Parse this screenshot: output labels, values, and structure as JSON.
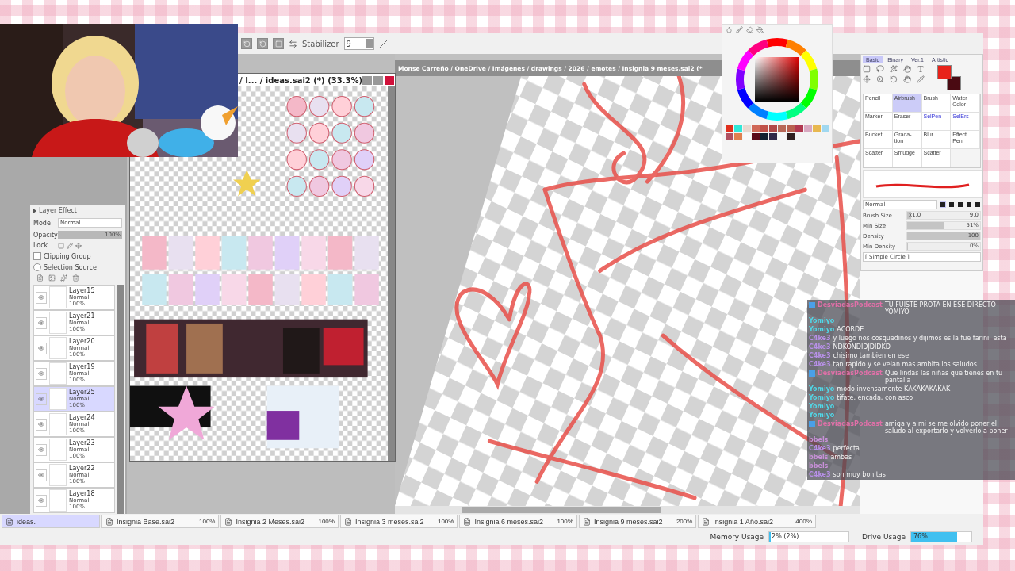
{
  "toolbar": {
    "stabilizer_label": "Stabilizer",
    "stabilizer_value": "9"
  },
  "ideas_window": {
    "title": "/ I... / ideas.sai2 (*) (33.3%)"
  },
  "canvas": {
    "path": "Monse Carreño / OneDrive / Imágenes / drawings / 2026 / emotes / Insignia 9 meses.sai2 (*"
  },
  "layer_effect": {
    "title": "Layer Effect",
    "mode_label": "Mode",
    "mode": "Normal",
    "opacity_label": "Opacity",
    "opacity": {
      "value": "100%",
      "level": 1
    },
    "lock_label": "Lock",
    "clipping_label": "Clipping Group",
    "clipping_checked": false,
    "selection_label": "Selection Source",
    "selection_checked": false
  },
  "layers": [
    {
      "name": "Layer15",
      "mode": "Normal",
      "opacity": "100%",
      "selected": false
    },
    {
      "name": "Layer21",
      "mode": "Normal",
      "opacity": "100%",
      "selected": false
    },
    {
      "name": "Layer20",
      "mode": "Normal",
      "opacity": "100%",
      "selected": false
    },
    {
      "name": "Layer19",
      "mode": "Normal",
      "opacity": "100%",
      "selected": false
    },
    {
      "name": "Layer25",
      "mode": "Normal",
      "opacity": "100%",
      "selected": true
    },
    {
      "name": "Layer24",
      "mode": "Normal",
      "opacity": "100%",
      "selected": false
    },
    {
      "name": "Layer23",
      "mode": "Normal",
      "opacity": "100%",
      "selected": false
    },
    {
      "name": "Layer22",
      "mode": "Normal",
      "opacity": "100%",
      "selected": false
    },
    {
      "name": "Layer18",
      "mode": "Normal",
      "opacity": "100%",
      "selected": false
    }
  ],
  "color_panel": {
    "swatches": [
      {
        "color": "#e0301e"
      },
      {
        "color": "#30e8d8"
      },
      {
        "color": "#e8d8d0"
      },
      {
        "color": "#d06858"
      },
      {
        "color": "#c05048"
      },
      {
        "color": "#b04848"
      },
      {
        "color": "#b86858"
      },
      {
        "color": "#b86050"
      },
      {
        "color": "#b03850"
      },
      {
        "color": "#d8a8c0"
      },
      {
        "color": "#e8b850"
      },
      {
        "color": "#a0d8f0"
      },
      {
        "color": "#b05060"
      },
      {
        "color": "#e08050"
      },
      {
        "color": "#f8f8f8"
      },
      {
        "color": "#5a0818"
      },
      {
        "color": "#102030"
      },
      {
        "color": "#302848"
      },
      {
        "color": "#f8f8f8"
      },
      {
        "color": "#302020"
      }
    ]
  },
  "tools": {
    "tabs": [
      {
        "label": "Basic",
        "selected": true
      },
      {
        "label": "Binary",
        "selected": false
      },
      {
        "label": "Ver.1",
        "selected": false
      },
      {
        "label": "Artistic",
        "selected": false
      }
    ],
    "colors": [
      {
        "color": "#e8221a"
      },
      {
        "color": "#4a0a12"
      }
    ],
    "brushes": [
      {
        "label": "Pencil",
        "kind": "paint",
        "selected": false
      },
      {
        "label": "Airbrush",
        "kind": "paint",
        "selected": true
      },
      {
        "label": "Brush",
        "kind": "paint",
        "selected": false
      },
      {
        "label": "Water Color",
        "kind": "paint",
        "selected": false
      },
      {
        "label": "Marker",
        "kind": "paint",
        "selected": false
      },
      {
        "label": "Eraser",
        "kind": "paint",
        "selected": false
      },
      {
        "label": "SelPen",
        "kind": "selection",
        "selected": false
      },
      {
        "label": "SelErs",
        "kind": "selection",
        "selected": false
      },
      {
        "label": "Bucket",
        "kind": "paint",
        "selected": false
      },
      {
        "label": "Grada- tion",
        "kind": "paint",
        "selected": false
      },
      {
        "label": "Blur",
        "kind": "paint",
        "selected": false
      },
      {
        "label": "Effect Pen",
        "kind": "paint",
        "selected": false
      },
      {
        "label": "Scatter",
        "kind": "paint",
        "selected": false
      },
      {
        "label": "Smudge",
        "kind": "paint",
        "selected": false
      },
      {
        "label": "Scatter",
        "kind": "paint",
        "selected": false
      }
    ],
    "blend_mode": "Normal",
    "params": [
      {
        "label": "Brush Size",
        "prefix": "x1.0",
        "value": "9.0",
        "level": 0.05
      },
      {
        "label": "Min Size",
        "value": "51%",
        "level": 0.51
      },
      {
        "label": "Density",
        "value": "100",
        "level": 1
      },
      {
        "label": "Min Density",
        "value": "0%",
        "level": 0
      }
    ],
    "shape": "[ Simple Circle ]"
  },
  "chat": [
    {
      "user": "DesviadasPodcast",
      "color": "#e070a8",
      "badge": true,
      "text": "TU FUISTE PROTA EN ESE DIRECTO YOMIYO"
    },
    {
      "user": "Yomiyo",
      "color": "#50d8e8"
    },
    {
      "user": "Yomiyo",
      "color": "#50d8e8",
      "text": "ACORDE"
    },
    {
      "user": "C4ke3",
      "color": "#b890e8",
      "text": "y luego nos cosquedinos y dijimos es la fue farini. esta"
    },
    {
      "user": "C4ke3",
      "color": "#b890e8",
      "text": "NDKONDIDJDIDKD"
    },
    {
      "user": "C4ke3",
      "color": "#b890e8",
      "text": "chisimo tambien en ese"
    },
    {
      "user": "C4ke3",
      "color": "#b890e8",
      "text": "tan rapido y se veian mas ambita los saludos"
    },
    {
      "user": "DesviadasPodcast",
      "color": "#e070a8",
      "badge": true,
      "text": "Que lindas las niñas que tienes en tu pantalla"
    },
    {
      "user": "Yomiyo",
      "color": "#50d8e8",
      "text": "modo invensamente KAKAKAKAKAK"
    },
    {
      "user": "Yomiyo",
      "color": "#50d8e8",
      "text": "tifate, encada, con asco"
    },
    {
      "user": "Yomiyo",
      "color": "#50d8e8"
    },
    {
      "user": "Yomiyo",
      "color": "#50d8e8"
    },
    {
      "user": "DesviadasPodcast",
      "color": "#e070a8",
      "badge": true,
      "text": "amiga y a mi se me olvido poner el saludo al exportarlo y volverlo a poner"
    },
    {
      "user": "bbels",
      "color": "#c890d8"
    },
    {
      "user": "C4ke3",
      "color": "#b890e8",
      "text": "perfecta"
    },
    {
      "user": "bbels",
      "color": "#c890d8",
      "text": "ambas"
    },
    {
      "user": "bbels",
      "color": "#c890d8"
    },
    {
      "user": "C4ke3",
      "color": "#b890e8",
      "text": "son muy bonitas"
    }
  ],
  "tabs": [
    {
      "label": "ideas.",
      "selected": true
    },
    {
      "label": "Insignia Base.sai2",
      "zoom": "100%",
      "selected": false
    },
    {
      "label": "Insignia 2 Meses.sai2",
      "zoom": "100%",
      "selected": false
    },
    {
      "label": "Insignia 3 meses.sai2",
      "zoom": "100%",
      "selected": false
    },
    {
      "label": "Insignia 6 meses.sai2",
      "zoom": "100%",
      "selected": false
    },
    {
      "label": "Insignia 9 meses.sai2",
      "zoom": "200%",
      "selected": false
    },
    {
      "label": "Insignia 1 Año.sai2",
      "zoom": "400%",
      "selected": false
    }
  ],
  "status": {
    "memory": {
      "label": "Memory Usage",
      "value": "2% (2%)",
      "level": 0.02
    },
    "drive": {
      "label": "Drive Usage",
      "value": "76%",
      "level": 0.76
    }
  }
}
